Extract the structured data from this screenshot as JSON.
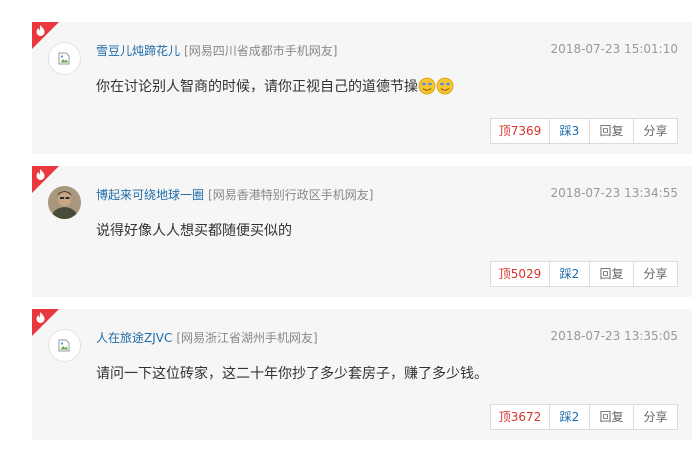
{
  "comments": [
    {
      "user": "雪豆儿炖蹄花儿",
      "location": "[网易四川省成都市手机网友]",
      "time": "2018-07-23 15:01:10",
      "text": "你在讨论别人智商的时候，请你正视自己的道德节操",
      "up": "顶7369",
      "down": "踩3",
      "reply": "回复",
      "share": "分享"
    },
    {
      "user": "博起来可绕地球一圈",
      "location": "[网易香港特别行政区手机网友]",
      "time": "2018-07-23 13:34:55",
      "text": "说得好像人人想买都随便买似的",
      "up": "顶5029",
      "down": "踩2",
      "reply": "回复",
      "share": "分享"
    },
    {
      "user": "人在旅途ZJVC",
      "location": "[网易浙江省湖州手机网友]",
      "time": "2018-07-23 13:35:05",
      "text": "请问一下这位砖家，这二十年你抄了多少套房子，赚了多少钱。",
      "up": "顶3672",
      "down": "踩2",
      "reply": "回复",
      "share": "分享"
    }
  ],
  "colors": {
    "hot_flag": "#e8383d",
    "user_name": "#1e6ba8",
    "up_vote": "#d9332e",
    "card_bg": "#f6f6f6"
  }
}
